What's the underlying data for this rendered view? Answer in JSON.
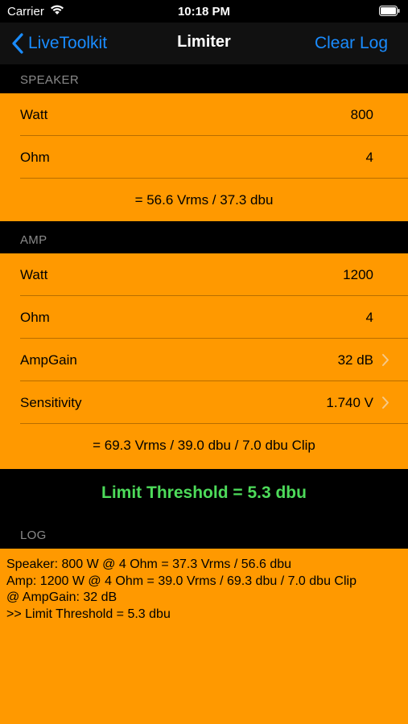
{
  "status": {
    "carrier": "Carrier",
    "time": "10:18 PM"
  },
  "nav": {
    "back_label": "LiveToolkit",
    "title": "Limiter",
    "action_label": "Clear Log"
  },
  "speaker": {
    "header": "SPEAKER",
    "watt_label": "Watt",
    "watt_value": "800",
    "ohm_label": "Ohm",
    "ohm_value": "4",
    "result": "= 56.6 Vrms / 37.3 dbu"
  },
  "amp": {
    "header": "AMP",
    "watt_label": "Watt",
    "watt_value": "1200",
    "ohm_label": "Ohm",
    "ohm_value": "4",
    "gain_label": "AmpGain",
    "gain_value": "32 dB",
    "sens_label": "Sensitivity",
    "sens_value": "1.740 V",
    "result": "= 69.3 Vrms / 39.0 dbu / 7.0 dbu Clip"
  },
  "threshold": "Limit Threshold = 5.3 dbu",
  "log": {
    "header": "LOG",
    "lines": [
      "Speaker: 800 W @ 4 Ohm = 37.3 Vrms / 56.6 dbu",
      "Amp: 1200 W @ 4 Ohm = 39.0 Vrms / 69.3 dbu / 7.0 dbu Clip",
      "@ AmpGain: 32 dB",
      ">> Limit Threshold = 5.3 dbu"
    ]
  },
  "colors": {
    "accent": "#1a8cff",
    "cell_bg": "#ff9900",
    "threshold_text": "#4ddb5a",
    "header_text": "#8a8a8a"
  }
}
